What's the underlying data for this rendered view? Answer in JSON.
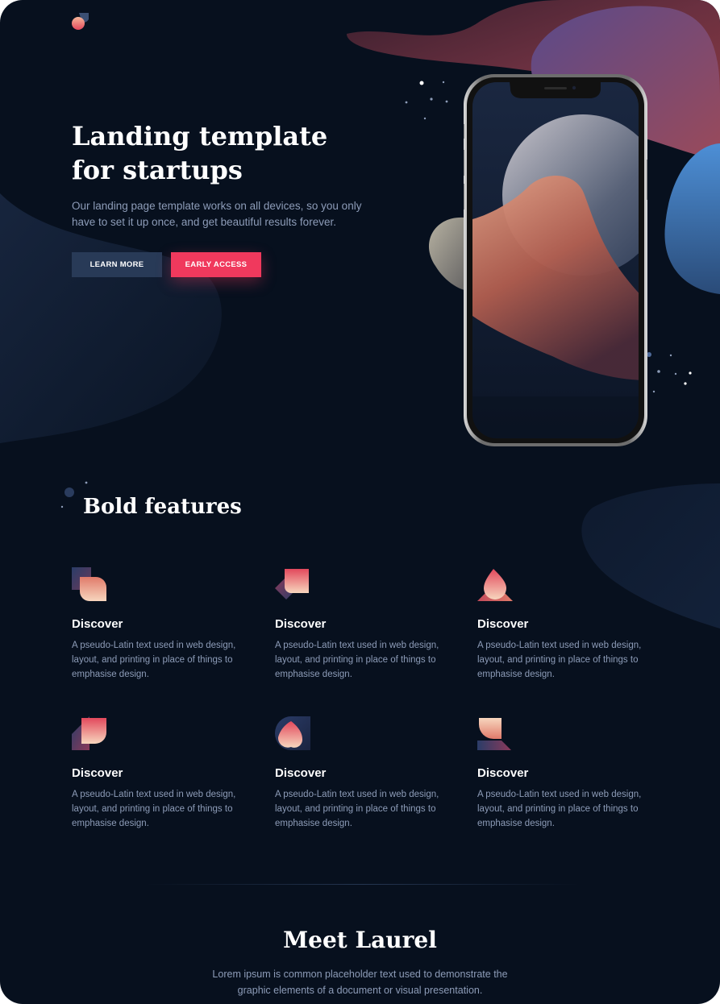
{
  "hero": {
    "title": "Landing template for startups",
    "subtitle": "Our landing page template works on all devices, so you only have to set it up once, and get beautiful results forever.",
    "learn_more_label": "LEARN MORE",
    "early_access_label": "EARLY ACCESS"
  },
  "features": {
    "title": "Bold features",
    "items": [
      {
        "icon": "feature-icon-1",
        "title": "Discover",
        "text": "A pseudo-Latin text used in web design, layout, and printing in place of things to emphasise design."
      },
      {
        "icon": "feature-icon-2",
        "title": "Discover",
        "text": "A pseudo-Latin text used in web design, layout, and printing in place of things to emphasise design."
      },
      {
        "icon": "feature-icon-3",
        "title": "Discover",
        "text": "A pseudo-Latin text used in web design, layout, and printing in place of things to emphasise design."
      },
      {
        "icon": "feature-icon-4",
        "title": "Discover",
        "text": "A pseudo-Latin text used in web design, layout, and printing in place of things to emphasise design."
      },
      {
        "icon": "feature-icon-5",
        "title": "Discover",
        "text": "A pseudo-Latin text used in web design, layout, and printing in place of things to emphasise design."
      },
      {
        "icon": "feature-icon-6",
        "title": "Discover",
        "text": "A pseudo-Latin text used in web design, layout, and printing in place of things to emphasise design."
      }
    ]
  },
  "meet": {
    "title": "Meet Laurel",
    "subtitle": "Lorem ipsum is common placeholder text used to demonstrate the graphic elements of a document or visual presentation."
  },
  "colors": {
    "background": "#07101e",
    "primary_button": "#283a57",
    "accent_button": "#f0395d",
    "muted_text": "#8d9cb8"
  }
}
